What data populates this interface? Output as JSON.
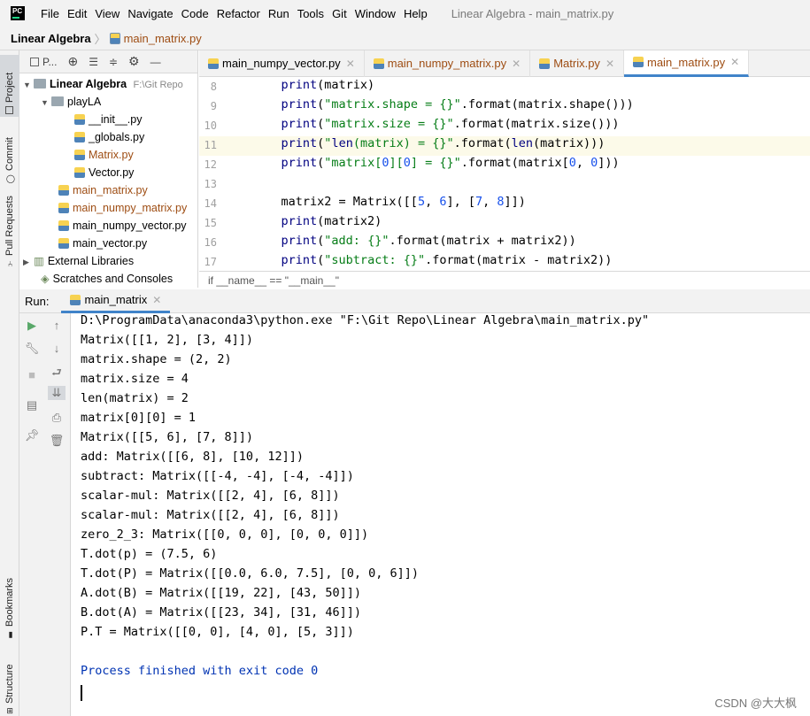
{
  "menubar": {
    "logo": "PC",
    "items": [
      "File",
      "Edit",
      "View",
      "Navigate",
      "Code",
      "Refactor",
      "Run",
      "Tools",
      "Git",
      "Window",
      "Help"
    ],
    "title": "Linear Algebra - main_matrix.py"
  },
  "navbar": {
    "project": "Linear Algebra",
    "file": "main_matrix.py"
  },
  "side_tabs": {
    "project": "Project",
    "commit": "Commit",
    "pull_requests": "Pull Requests",
    "bookmarks": "Bookmarks",
    "structure": "Structure"
  },
  "project_panel": {
    "toolbar_label": "P...",
    "root": "Linear Algebra",
    "root_path": "F:\\Git Repo",
    "folder": "playLA",
    "folder_files": [
      "__init__.py",
      "_globals.py",
      "Matrix.py",
      "Vector.py"
    ],
    "root_files": [
      "main_matrix.py",
      "main_numpy_matrix.py",
      "main_numpy_vector.py",
      "main_vector.py"
    ],
    "external_libraries": "External Libraries",
    "scratches": "Scratches and Consoles"
  },
  "editor": {
    "tabs": [
      "main_numpy_vector.py",
      "main_numpy_matrix.py",
      "Matrix.py",
      "main_matrix.py"
    ],
    "line_numbers": [
      "8",
      "9",
      "10",
      "11",
      "12",
      "13",
      "14",
      "15",
      "16",
      "17"
    ],
    "lines": [
      "    print(matrix)",
      "    print(\"matrix.shape = {}\".format(matrix.shape()))",
      "    print(\"matrix.size = {}\".format(matrix.size()))",
      "    print(\"len(matrix) = {}\".format(len(matrix)))",
      "    print(\"matrix[0][0] = {}\".format(matrix[0, 0]))",
      "",
      "    matrix2 = Matrix([[5, 6], [7, 8]])",
      "    print(matrix2)",
      "    print(\"add: {}\".format(matrix + matrix2))",
      "    print(\"subtract: {}\".format(matrix - matrix2))"
    ],
    "breadcrumb": "if __name__ == \"__main__\""
  },
  "run": {
    "label": "Run:",
    "tab": "main_matrix",
    "output": [
      "D:\\ProgramData\\anaconda3\\python.exe \"F:\\Git Repo\\Linear Algebra\\main_matrix.py\"",
      "Matrix([[1, 2], [3, 4]])",
      "matrix.shape = (2, 2)",
      "matrix.size = 4",
      "len(matrix) = 2",
      "matrix[0][0] = 1",
      "Matrix([[5, 6], [7, 8]])",
      "add: Matrix([[6, 8], [10, 12]])",
      "subtract: Matrix([[-4, -4], [-4, -4]])",
      "scalar-mul: Matrix([[2, 4], [6, 8]])",
      "scalar-mul: Matrix([[2, 4], [6, 8]])",
      "zero_2_3: Matrix([[0, 0, 0], [0, 0, 0]])",
      "T.dot(p) = (7.5, 6)",
      "T.dot(P) = Matrix([[0.0, 6.0, 7.5], [0, 0, 6]])",
      "A.dot(B) = Matrix([[19, 22], [43, 50]])",
      "B.dot(A) = Matrix([[23, 34], [31, 46]])",
      "P.T = Matrix([[0, 0], [4, 0], [5, 3]])",
      "",
      "Process finished with exit code 0"
    ]
  },
  "watermark": "CSDN @大大枫",
  "colors": {
    "accent": "#4083c9",
    "modified_file": "#9e4d13",
    "keyword_builtin": "#000080",
    "string": "#067d17",
    "number": "#1750eb",
    "process_text": "#0033b3",
    "run_green": "#59a869"
  }
}
